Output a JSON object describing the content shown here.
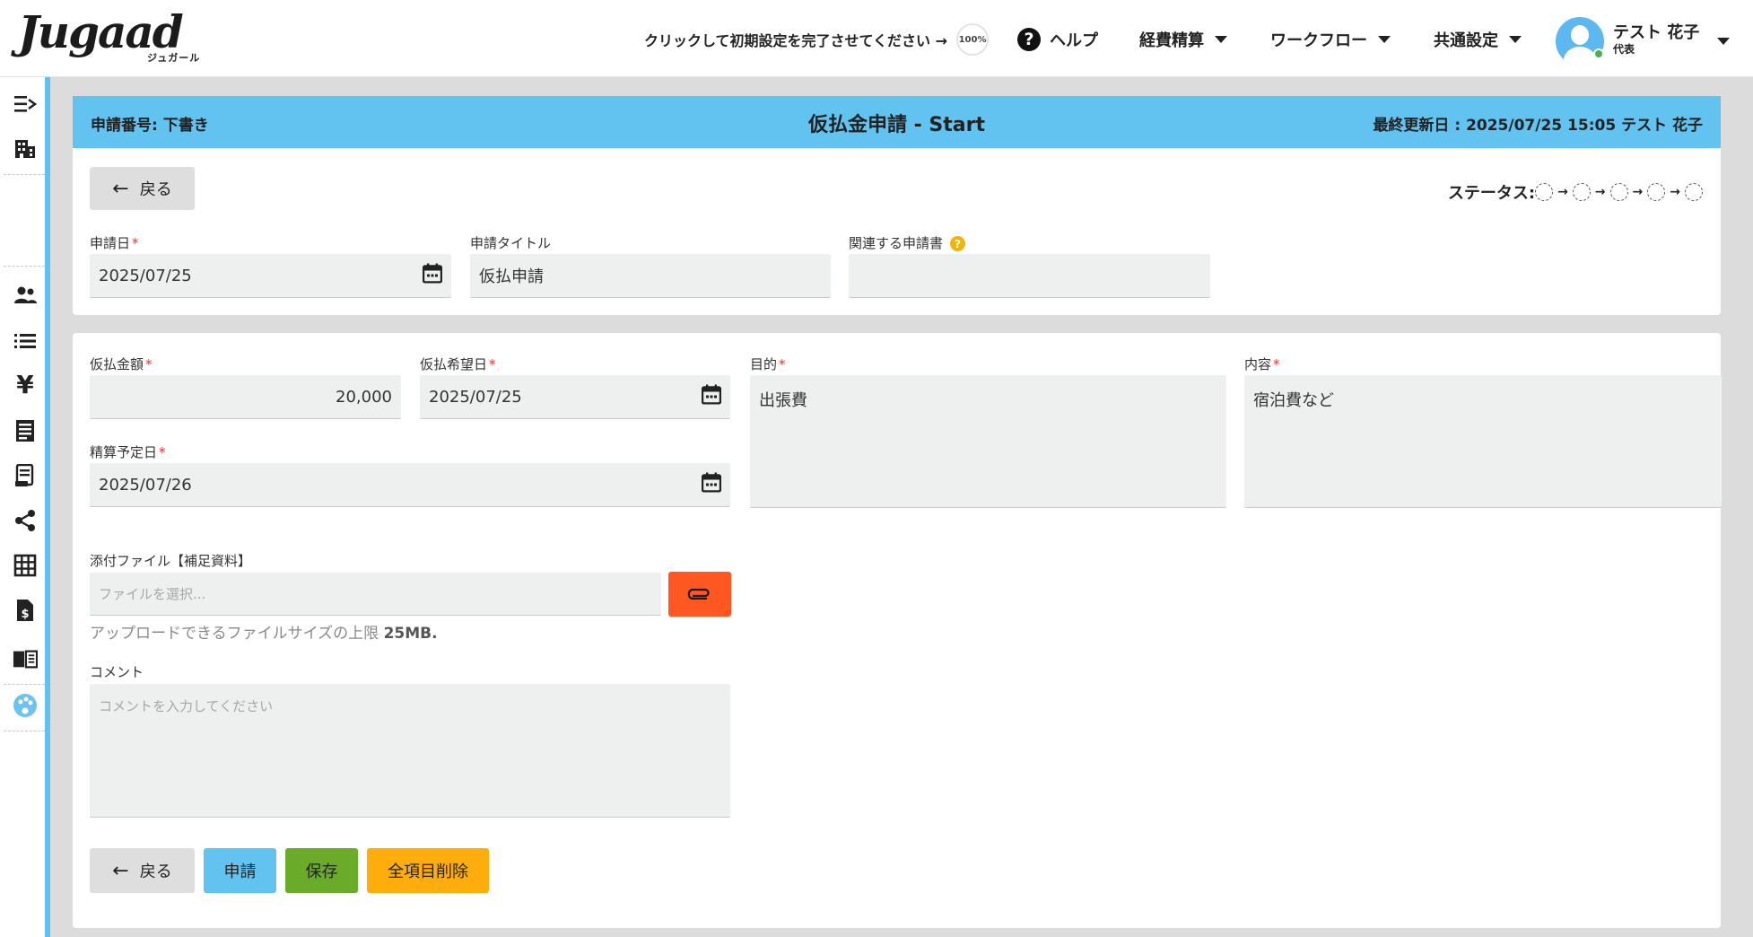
{
  "header": {
    "logo_text": "Jugaad",
    "logo_sub": "ジュガール",
    "setup_text": "クリックして初期設定を完了させてください →",
    "setup_progress": "100%",
    "help_label": "ヘルプ",
    "nav": [
      {
        "label": "経費精算"
      },
      {
        "label": "ワークフロー"
      },
      {
        "label": "共通設定"
      }
    ],
    "user_name": "テスト 花子",
    "user_role": "代表"
  },
  "sidebar": {
    "icons": [
      "menu-expand-icon",
      "building-icon",
      "users-icon",
      "list-icon",
      "yen-icon",
      "receipt-icon",
      "document-icon",
      "share-icon",
      "grid-icon",
      "invoice-icon",
      "book-icon",
      "palette-icon"
    ],
    "accent_color": "#60c1ee"
  },
  "titlebar": {
    "left": "申請番号: 下書き",
    "center": "仮払金申請 - Start",
    "right": "最終更新日 : 2025/07/25 15:05 テスト 花子"
  },
  "card1": {
    "back_label": "戻る",
    "status_label": "ステータス:",
    "status_steps": 5,
    "fields": {
      "apply_date": {
        "label": "申請日",
        "value": "2025/07/25"
      },
      "apply_title": {
        "label": "申請タイトル",
        "value": "仮払申請"
      },
      "related": {
        "label": "関連する申請書",
        "value": "",
        "hint": "?"
      }
    }
  },
  "card2": {
    "fields": {
      "amount": {
        "label": "仮払金額",
        "value": "20,000"
      },
      "desired_date": {
        "label": "仮払希望日",
        "value": "2025/07/25"
      },
      "purpose": {
        "label": "目的",
        "value": "出張費"
      },
      "content": {
        "label": "内容",
        "value": "宿泊費など"
      },
      "settle_date": {
        "label": "精算予定日",
        "value": "2025/07/26"
      },
      "attachment": {
        "label": "添付ファイル【補足資料】",
        "placeholder": "ファイルを選択..."
      },
      "comment": {
        "label": "コメント",
        "placeholder": "コメントを入力してください"
      }
    },
    "upload_note": "アップロードできるファイルサイズの上限",
    "upload_limit": "25MB.",
    "buttons": {
      "back": "戻る",
      "submit": "申請",
      "save": "保存",
      "clear": "全項目削除"
    },
    "colors": {
      "submit": "#63c3f0",
      "save": "#6aab2a",
      "clear": "#ffad0c",
      "attach": "#ff5722"
    }
  },
  "required_mark": "*"
}
